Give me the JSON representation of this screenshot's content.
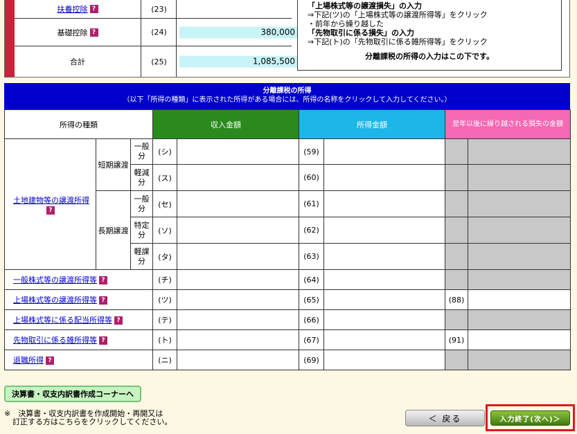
{
  "top_rows": [
    {
      "label": "扶養控除",
      "link": true,
      "help": "?",
      "num": "(23)",
      "value": ""
    },
    {
      "label": "基礎控除",
      "link": false,
      "help": "?",
      "num": "(24)",
      "value": "380,000"
    },
    {
      "label": "合計",
      "link": false,
      "help": "",
      "num": "(25)",
      "value": "1,085,500"
    }
  ],
  "note": {
    "lines": [
      "「上場株式等の譲渡損失」の入力",
      "⇒下記(ツ)の「上場株式等の譲渡所得等」をクリック",
      "・前年から繰り越した",
      "「先物取引に係る損失」の入力",
      "⇒下記(ト)の「先物取引に係る雑所得等」をクリック"
    ],
    "footer": "分離課税の所得の入力はこの下です。"
  },
  "section": {
    "title": "分離課税の所得",
    "subtitle": "（以下「所得の種類」に表示された所得がある場合には、所得の名称をクリックして入力してください。）"
  },
  "headers": {
    "kind": "所得の種類",
    "income": "収入金額",
    "amount": "所得金額",
    "loss": "翌年以後に繰り越される損失の金額"
  },
  "land": {
    "label": "土地建物等の譲渡所得",
    "short_term": "短期譲渡",
    "long_term": "長期譲渡",
    "rows": [
      {
        "sub": "一般分",
        "kana": "(シ)",
        "num": "(59)"
      },
      {
        "sub": "軽減分",
        "kana": "(ス)",
        "num": "(60)"
      },
      {
        "sub": "一般分",
        "kana": "(セ)",
        "num": "(61)"
      },
      {
        "sub": "特定分",
        "kana": "(ソ)",
        "num": "(62)"
      },
      {
        "sub": "軽課分",
        "kana": "(タ)",
        "num": "(63)"
      }
    ]
  },
  "other_rows": [
    {
      "label": "一般株式等の譲渡所得等",
      "kana": "(チ)",
      "num": "(64)",
      "loss_num": ""
    },
    {
      "label": "上場株式等の譲渡所得等",
      "kana": "(ツ)",
      "num": "(65)",
      "loss_num": "(88)"
    },
    {
      "label": "上場株式等に係る配当所得等",
      "kana": "(テ)",
      "num": "(66)",
      "loss_num": ""
    },
    {
      "label": "先物取引に係る雑所得等",
      "kana": "(ト)",
      "num": "(67)",
      "loss_num": "(91)"
    },
    {
      "label": "退職所得",
      "kana": "(ニ)",
      "num": "(69)",
      "loss_num": ""
    }
  ],
  "help_mark": "?",
  "buttons": {
    "kessan": "決算書・収支内訳書作成コーナーへ",
    "back": "＜ 戻る",
    "next": "入力終了(次へ)＞"
  },
  "footnote": {
    "line1": "※　決算書・収支内訳書を作成開始・再開又は",
    "line2": "訂正する方はこちらをクリックしてください。"
  }
}
